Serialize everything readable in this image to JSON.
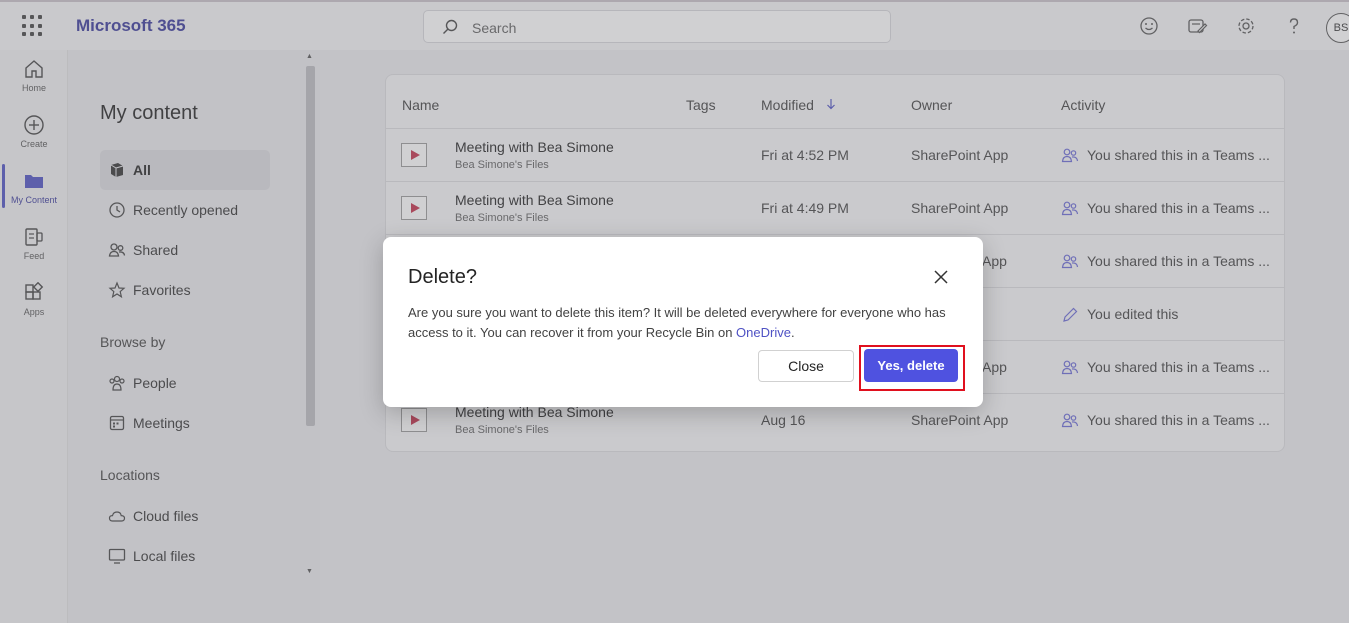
{
  "app": {
    "brand": "Microsoft 365",
    "avatar_initials": "BS"
  },
  "search": {
    "placeholder": "Search"
  },
  "rail": [
    {
      "label": "Home",
      "icon": "home-icon"
    },
    {
      "label": "Create",
      "icon": "create-icon"
    },
    {
      "label": "My Content",
      "icon": "folder-icon",
      "active": true
    },
    {
      "label": "Feed",
      "icon": "feed-icon"
    },
    {
      "label": "Apps",
      "icon": "apps-icon"
    }
  ],
  "sidebar": {
    "title": "My content",
    "items": [
      {
        "label": "All",
        "icon": "all-icon",
        "active": true
      },
      {
        "label": "Recently opened",
        "icon": "clock-icon"
      },
      {
        "label": "Shared",
        "icon": "shared-icon"
      },
      {
        "label": "Favorites",
        "icon": "star-icon"
      }
    ],
    "browse_heading": "Browse by",
    "browse": [
      {
        "label": "People",
        "icon": "people-icon"
      },
      {
        "label": "Meetings",
        "icon": "calendar-icon"
      }
    ],
    "locations_heading": "Locations",
    "locations": [
      {
        "label": "Cloud files",
        "icon": "cloud-icon"
      },
      {
        "label": "Local files",
        "icon": "monitor-icon"
      }
    ]
  },
  "table": {
    "columns": {
      "name": "Name",
      "tags": "Tags",
      "modified": "Modified",
      "owner": "Owner",
      "activity": "Activity"
    },
    "rows": [
      {
        "name": "Meeting with Bea Simone",
        "location": "Bea Simone's Files",
        "modified": "Fri at 4:52 PM",
        "owner": "SharePoint App",
        "activity": "You shared this in a Teams ...",
        "activity_icon": "people-icon"
      },
      {
        "name": "Meeting with Bea Simone",
        "location": "Bea Simone's Files",
        "modified": "Fri at 4:49 PM",
        "owner": "SharePoint App",
        "activity": "You shared this in a Teams ...",
        "activity_icon": "people-icon"
      },
      {
        "name": "",
        "location": "",
        "modified": "",
        "owner": "App",
        "activity": "You shared this in a Teams ...",
        "activity_icon": "people-icon"
      },
      {
        "name": "",
        "location": "",
        "modified": "",
        "owner": "",
        "activity": "You edited this",
        "activity_icon": "pencil-icon"
      },
      {
        "name": "",
        "location": "",
        "modified": "",
        "owner": "App",
        "activity": "You shared this in a Teams ...",
        "activity_icon": "people-icon"
      },
      {
        "name": "Meeting with Bea Simone",
        "location": "Bea Simone's Files",
        "modified": "Aug 16",
        "owner": "SharePoint App",
        "activity": "You shared this in a Teams ...",
        "activity_icon": "people-icon"
      }
    ]
  },
  "dialog": {
    "title": "Delete?",
    "body_prefix": "Are you sure you want to delete this item? It will be deleted everywhere for everyone who has access to it. You can recover it from your Recycle Bin on ",
    "body_link": "OneDrive",
    "body_suffix": ".",
    "close_label": "Close",
    "confirm_label": "Yes, delete"
  },
  "colors": {
    "accent": "#4f52e0",
    "highlight": "#e0101e",
    "brand": "#3a3a9c"
  }
}
